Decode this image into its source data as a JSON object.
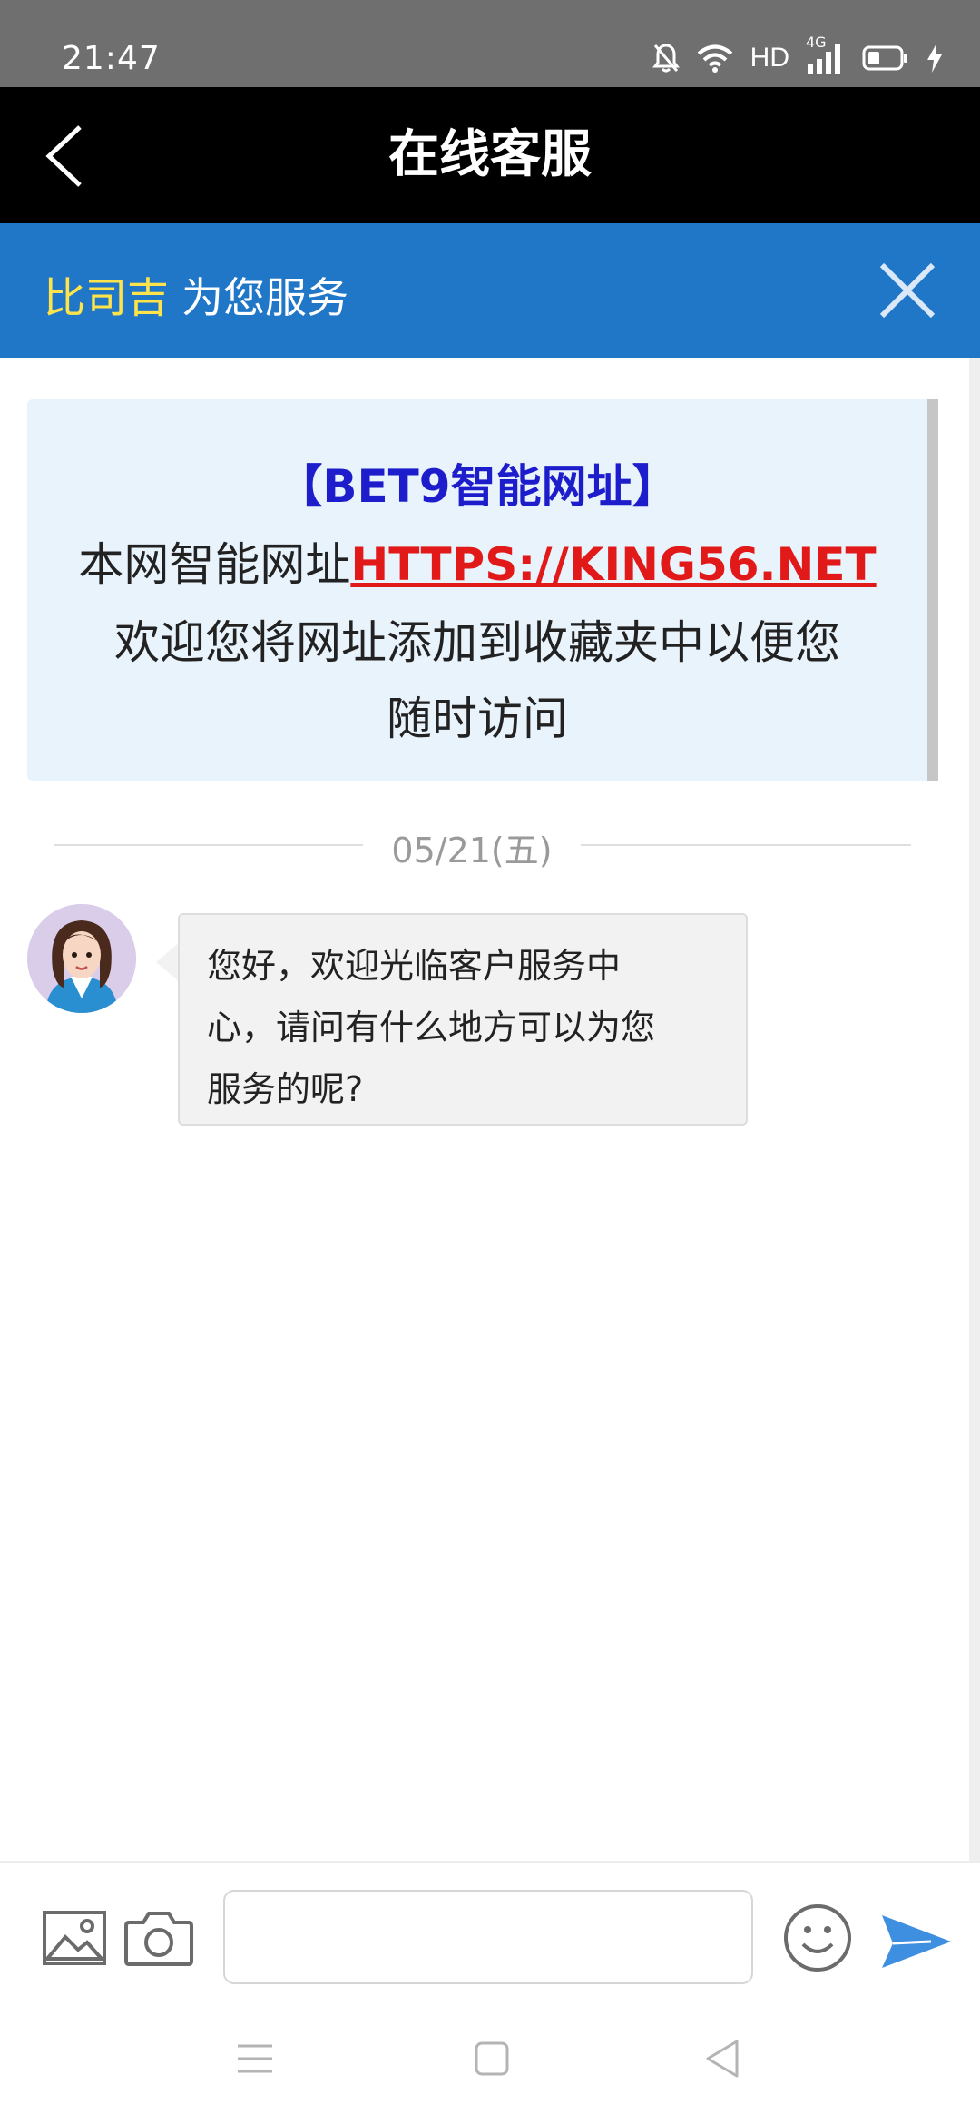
{
  "status_bar": {
    "time": "21:47",
    "hd_label": "HD",
    "network_label": "4G",
    "icons": [
      "bell-off-icon",
      "wifi-icon",
      "signal-icon",
      "battery-icon",
      "charging-icon"
    ]
  },
  "header": {
    "title": "在线客服",
    "back_icon": "chevron-left-icon"
  },
  "service_banner": {
    "agent_name": "比司吉",
    "text": "为您服务",
    "close_icon": "close-icon"
  },
  "notice": {
    "title": "【BET9智能网址】",
    "line2_prefix": "本网智能网址",
    "link": "HTTPS://KING56.NET",
    "line3": "欢迎您将网址添加到收藏夹中以便您",
    "line4": "随时访问"
  },
  "conversation": {
    "date": "05/21(五)",
    "messages": [
      {
        "sender": "agent",
        "avatar_icon": "agent-avatar-icon",
        "lines": [
          "您好，欢迎光临客户服务中",
          "心，请问有什么地方可以为您",
          "服务的呢?"
        ]
      }
    ]
  },
  "input_bar": {
    "input_value": "",
    "input_placeholder": "",
    "icons": [
      "image-icon",
      "camera-icon",
      "emoji-icon",
      "send-icon"
    ]
  },
  "nav_bar": {
    "icons": [
      "menu-icon",
      "home-icon",
      "back-triangle-icon"
    ]
  },
  "colors": {
    "status_bar": "#6f6f6f",
    "header": "#000000",
    "banner": "#2177c7",
    "agent_name": "#ffe34a",
    "notice_bg": "#e9f3fc",
    "notice_title": "#1d1dcc",
    "notice_link": "#e21919",
    "send_icon": "#3f8fe0"
  }
}
